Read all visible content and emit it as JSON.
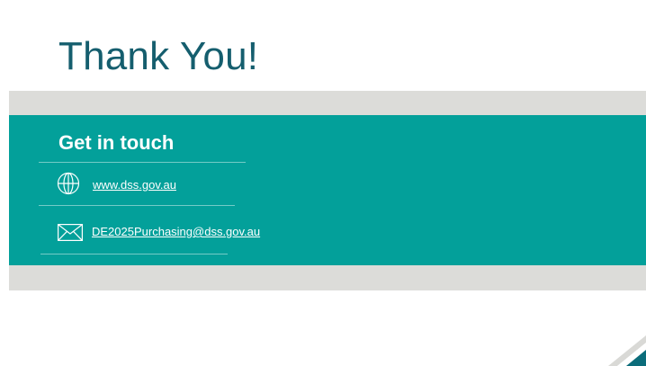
{
  "slide": {
    "title": "Thank You!"
  },
  "contact": {
    "heading": "Get in touch",
    "website": "www.dss.gov.au",
    "email": "DE2025Purchasing@dss.gov.au"
  },
  "icons": {
    "website": "globe-icon",
    "email": "envelope-icon"
  },
  "colors": {
    "title": "#155e6e",
    "teal_band": "#03a09a",
    "grey_band": "#dcdcd9",
    "corner_accent": "#0b6c7a"
  }
}
